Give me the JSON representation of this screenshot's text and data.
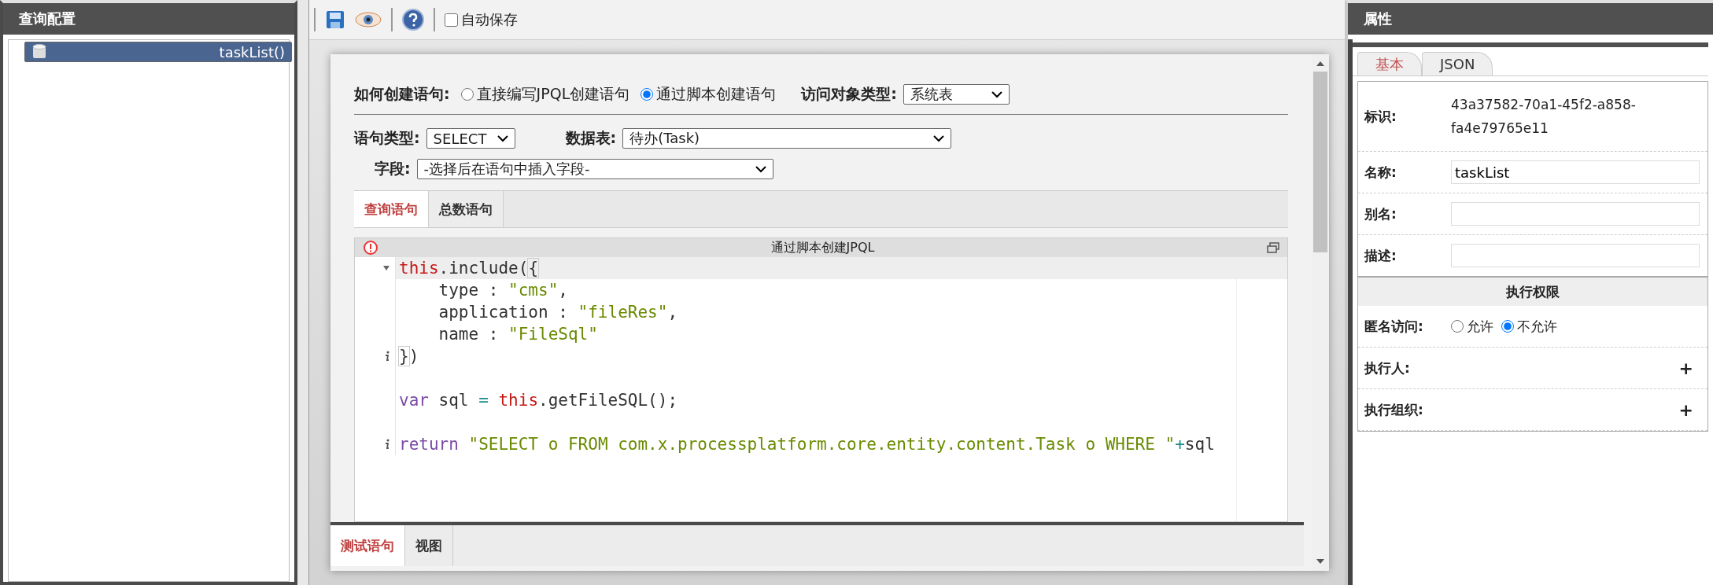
{
  "left_panel": {
    "title": "查询配置",
    "tree": [
      {
        "label": "taskList()",
        "selected": true
      }
    ]
  },
  "toolbar": {
    "autosave": {
      "label": "自动保存",
      "checked": false
    }
  },
  "form": {
    "creation_label": "如何创建语句:",
    "creation_options": [
      {
        "label": "直接编写JPQL创建语句",
        "selected": false
      },
      {
        "label": "通过脚本创建语句",
        "selected": true
      }
    ],
    "object_type_label": "访问对象类型:",
    "object_type_value": "系统表",
    "statement_type_label": "语句类型:",
    "statement_type_value": "SELECT",
    "table_label": "数据表:",
    "table_value": "待办(Task)",
    "field_label": "字段:",
    "field_value": "-选择后在语句中插入字段-"
  },
  "query_tabs": [
    {
      "label": "查询语句",
      "selected": true
    },
    {
      "label": "总数语句",
      "selected": false
    }
  ],
  "editor": {
    "title": "通过脚本创建JPQL",
    "lines": [
      {
        "foldable": true,
        "active": true,
        "tokens": [
          {
            "kind": "this",
            "text": "this"
          },
          {
            "kind": "plain",
            "text": ".include("
          },
          {
            "kind": "bracket",
            "text": "{"
          }
        ]
      },
      {
        "active": false,
        "tokens": [
          {
            "kind": "plain",
            "text": "    type : "
          },
          {
            "kind": "string",
            "text": "\"cms\""
          },
          {
            "kind": "plain",
            "text": ","
          }
        ]
      },
      {
        "active": false,
        "tokens": [
          {
            "kind": "plain",
            "text": "    application : "
          },
          {
            "kind": "string",
            "text": "\"fileRes\""
          },
          {
            "kind": "plain",
            "text": ","
          }
        ]
      },
      {
        "active": false,
        "tokens": [
          {
            "kind": "plain",
            "text": "    name : "
          },
          {
            "kind": "string",
            "text": "\"FileSql\""
          }
        ]
      },
      {
        "has_info": true,
        "active": false,
        "tokens": [
          {
            "kind": "bracket",
            "text": "}"
          },
          {
            "kind": "plain",
            "text": ")"
          }
        ]
      },
      {
        "active": false
      },
      {
        "active": false,
        "tokens": [
          {
            "kind": "keyword",
            "text": "var"
          },
          {
            "kind": "plain",
            "text": " sql "
          },
          {
            "kind": "operator",
            "text": "= "
          },
          {
            "kind": "this",
            "text": "this"
          },
          {
            "kind": "plain",
            "text": ".getFileSQL();"
          }
        ]
      },
      {
        "active": false
      },
      {
        "has_info": true,
        "active": false,
        "tokens": [
          {
            "kind": "keyword",
            "text": "return "
          },
          {
            "kind": "string",
            "text": "\"SELECT o FROM com.x.processplatform.core.entity.content.Task o WHERE \""
          },
          {
            "kind": "operator",
            "text": "+"
          },
          {
            "kind": "plain",
            "text": "sql"
          }
        ]
      }
    ]
  },
  "bottom_tabs": [
    {
      "label": "测试语句",
      "selected": true
    },
    {
      "label": "视图",
      "selected": false
    }
  ],
  "right_panel": {
    "title": "属性",
    "tabs": [
      {
        "label": "基本",
        "selected": true
      },
      {
        "label": "JSON",
        "selected": false
      }
    ],
    "id_label": "标识:",
    "id_value_lines": [
      "43a37582-70a1-45f2-a858-",
      "fa4e79765e11"
    ],
    "name_label": "名称:",
    "name_value": "taskList",
    "alias_label": "别名:",
    "description_label": "描述:",
    "section_title": "执行权限",
    "anonymous_label": "匿名访问:",
    "anonymous_options": [
      {
        "label": "允许",
        "selected": false
      },
      {
        "label": "不允许",
        "selected": true
      }
    ],
    "executor_label": "执行人:",
    "executor_add": "+",
    "exec_org_label": "执行组织:",
    "exec_org_add": "+"
  }
}
